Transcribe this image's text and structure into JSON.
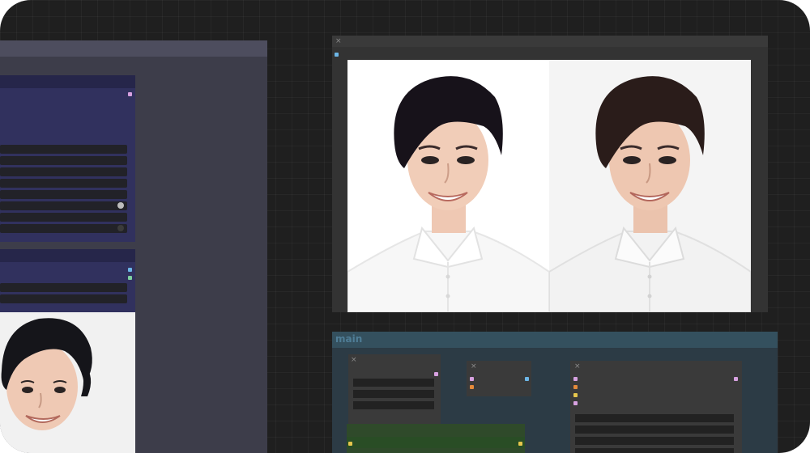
{
  "window": {
    "background": "#1f1f1f",
    "grid": true
  },
  "group_left": {
    "color": "#3d3d4a",
    "title": ""
  },
  "group_main": {
    "title": "main",
    "color": "#2c3b45"
  },
  "preview_node": {
    "title": "",
    "images": [
      {
        "name": "before-portrait",
        "description_visible": false
      },
      {
        "name": "after-portrait",
        "description_visible": false
      }
    ]
  },
  "icons": {
    "close": "×",
    "node_close": "close-icon",
    "port": "connection-port"
  },
  "colors": {
    "port_pink": "#d7a1e0",
    "port_blue": "#6db6e6",
    "port_green": "#7fd0a0",
    "port_orange": "#e58a3a",
    "port_yellow": "#e6c64d",
    "node_blue": "#31315e",
    "node_green": "#2f4a2a"
  }
}
